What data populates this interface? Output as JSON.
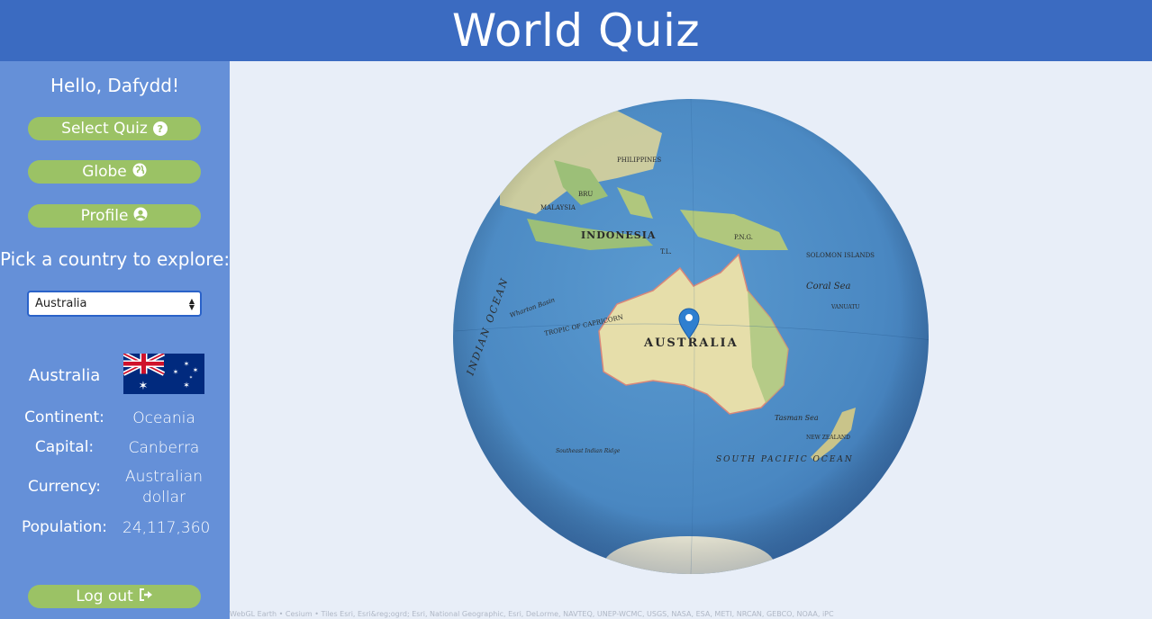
{
  "header": {
    "title": "World Quiz"
  },
  "sidebar": {
    "greeting": "Hello, Dafydd!",
    "nav": [
      {
        "label": "Select Quiz",
        "icon": "question-circle-icon"
      },
      {
        "label": "Globe",
        "icon": "globe-icon"
      },
      {
        "label": "Profile",
        "icon": "user-circle-icon"
      }
    ],
    "pick_label": "Pick a country to explore:",
    "country_select": {
      "selected": "Australia"
    },
    "country": {
      "name": "Australia",
      "fields": [
        {
          "label": "Continent:",
          "value": "Oceania"
        },
        {
          "label": "Capital:",
          "value": "Canberra"
        },
        {
          "label": "Currency:",
          "value": "Australian dollar"
        },
        {
          "label": "Population:",
          "value": "24,117,360"
        }
      ]
    },
    "logout": {
      "label": "Log out",
      "icon": "sign-out-icon"
    }
  },
  "map": {
    "labels": {
      "australia": "AUSTRALIA",
      "indonesia": "INDONESIA",
      "malaysia": "MALAYSIA",
      "philippines": "PHILIPPINES",
      "png": "P.N.G.",
      "solomon": "SOLOMON ISLANDS",
      "vanuatu": "VANUATU",
      "coral_sea": "Coral Sea",
      "tasman_sea": "Tasman Sea",
      "new_zealand": "NEW ZEALAND",
      "indian_ocean": "INDIAN OCEAN",
      "south_pacific": "SOUTH PACIFIC OCEAN",
      "capricorn": "TROPIC OF CAPRICORN",
      "wharton": "Wharton Basin",
      "se_ridge": "Southeast Indian Ridge",
      "tl": "T.L.",
      "brunei": "BRU"
    }
  },
  "attribution": "WebGL Earth • Cesium • Tiles Esri, Esri&reg;ogrd; Esri, National Geographic, Esri, DeLorme, NAVTEQ, UNEP-WCMC, USGS, NASA, ESA, METI, NRCAN, GEBCO, NOAA, iPC",
  "colors": {
    "header": "#3b6bc1",
    "sidebar": "#6590d8",
    "button": "#9bc265",
    "map_background": "#e8eef8",
    "ocean": "#4f8fc6",
    "land": "#e8dfa8",
    "marker": "#2f7fd0"
  }
}
